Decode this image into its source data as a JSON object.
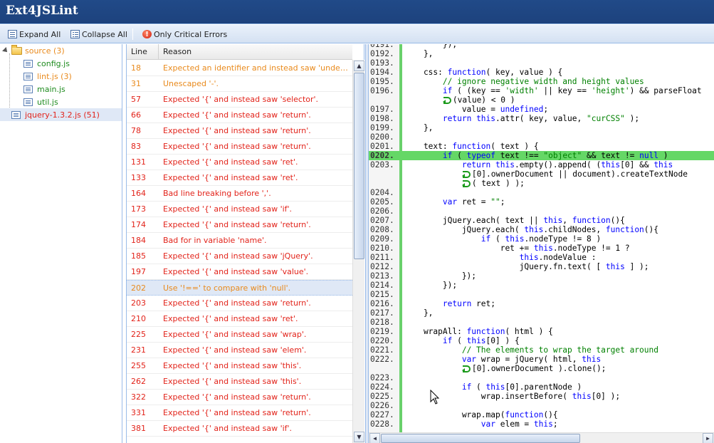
{
  "app": {
    "title": "Ext4JSLint"
  },
  "toolbar": {
    "expand_all": "Expand All",
    "collapse_all": "Collapse All",
    "only_critical": "Only Critical Errors"
  },
  "tree": {
    "items": [
      {
        "label": "source (3)",
        "type": "folder",
        "color": "orange"
      },
      {
        "label": "config.js",
        "type": "file",
        "color": "green"
      },
      {
        "label": "lint.js (3)",
        "type": "file",
        "color": "orange"
      },
      {
        "label": "main.js",
        "type": "file",
        "color": "green"
      },
      {
        "label": "util.js",
        "type": "file",
        "color": "green"
      },
      {
        "label": "jquery-1.3.2.js (51)",
        "type": "file",
        "color": "red",
        "selected": true
      }
    ]
  },
  "grid": {
    "columns": {
      "line": "Line",
      "reason": "Reason"
    },
    "rows": [
      {
        "line": "18",
        "reason": "Expected an identifier and instead saw 'undefined' (...",
        "severity": "orange"
      },
      {
        "line": "31",
        "reason": "Unescaped '-'.",
        "severity": "orange"
      },
      {
        "line": "57",
        "reason": "Expected '{' and instead saw 'selector'.",
        "severity": "red"
      },
      {
        "line": "66",
        "reason": "Expected '{' and instead saw 'return'.",
        "severity": "red"
      },
      {
        "line": "78",
        "reason": "Expected '{' and instead saw 'return'.",
        "severity": "red"
      },
      {
        "line": "83",
        "reason": "Expected '{' and instead saw 'return'.",
        "severity": "red"
      },
      {
        "line": "131",
        "reason": "Expected '{' and instead saw 'ret'.",
        "severity": "red"
      },
      {
        "line": "133",
        "reason": "Expected '{' and instead saw 'ret'.",
        "severity": "red"
      },
      {
        "line": "164",
        "reason": "Bad line breaking before ','.",
        "severity": "red"
      },
      {
        "line": "173",
        "reason": "Expected '{' and instead saw 'if'.",
        "severity": "red"
      },
      {
        "line": "174",
        "reason": "Expected '{' and instead saw 'return'.",
        "severity": "red"
      },
      {
        "line": "184",
        "reason": "Bad for in variable 'name'.",
        "severity": "red"
      },
      {
        "line": "185",
        "reason": "Expected '{' and instead saw 'jQuery'.",
        "severity": "red"
      },
      {
        "line": "197",
        "reason": "Expected '{' and instead saw 'value'.",
        "severity": "red"
      },
      {
        "line": "202",
        "reason": "Use '!==' to compare with 'null'.",
        "severity": "orange",
        "selected": true
      },
      {
        "line": "203",
        "reason": "Expected '{' and instead saw 'return'.",
        "severity": "red"
      },
      {
        "line": "210",
        "reason": "Expected '{' and instead saw 'ret'.",
        "severity": "red"
      },
      {
        "line": "225",
        "reason": "Expected '{' and instead saw 'wrap'.",
        "severity": "red"
      },
      {
        "line": "231",
        "reason": "Expected '{' and instead saw 'elem'.",
        "severity": "red"
      },
      {
        "line": "255",
        "reason": "Expected '{' and instead saw 'this'.",
        "severity": "red"
      },
      {
        "line": "262",
        "reason": "Expected '{' and instead saw 'this'.",
        "severity": "red"
      },
      {
        "line": "322",
        "reason": "Expected '{' and instead saw 'return'.",
        "severity": "red"
      },
      {
        "line": "331",
        "reason": "Expected '{' and instead saw 'return'.",
        "severity": "red"
      },
      {
        "line": "381",
        "reason": "Expected '{' and instead saw 'if'.",
        "severity": "red"
      }
    ]
  },
  "code": {
    "highlighted_line": "0202.",
    "lines": [
      {
        "num": "0191.",
        "text": "        });"
      },
      {
        "num": "0192.",
        "text": "    },"
      },
      {
        "num": "0193.",
        "text": ""
      },
      {
        "num": "0194.",
        "text": "    css: function( key, value ) {"
      },
      {
        "num": "0195.",
        "text": "        // ignore negative width and height values"
      },
      {
        "num": "0196.",
        "text": "        if ( (key == 'width' || key == 'height') && parseFloat"
      },
      {
        "num": "",
        "text": "(value) < 0 )",
        "wrapped": true,
        "indent": 8
      },
      {
        "num": "0197.",
        "text": "            value = undefined;"
      },
      {
        "num": "0198.",
        "text": "        return this.attr( key, value, \"curCSS\" );"
      },
      {
        "num": "0199.",
        "text": "    },"
      },
      {
        "num": "0200.",
        "text": ""
      },
      {
        "num": "0201.",
        "text": "    text: function( text ) {"
      },
      {
        "num": "0202.",
        "text": "        if ( typeof text !== \"object\" && text != null )"
      },
      {
        "num": "0203.",
        "text": "            return this.empty().append( (this[0] && this"
      },
      {
        "num": "",
        "text": "[0].ownerDocument || document).createTextNode",
        "wrapped": true,
        "indent": 12
      },
      {
        "num": "",
        "text": "( text ) );",
        "wrapped": true,
        "indent": 12
      },
      {
        "num": "0204.",
        "text": ""
      },
      {
        "num": "0205.",
        "text": "        var ret = \"\";"
      },
      {
        "num": "0206.",
        "text": ""
      },
      {
        "num": "0207.",
        "text": "        jQuery.each( text || this, function(){"
      },
      {
        "num": "0208.",
        "text": "            jQuery.each( this.childNodes, function(){"
      },
      {
        "num": "0209.",
        "text": "                if ( this.nodeType != 8 )"
      },
      {
        "num": "0210.",
        "text": "                    ret += this.nodeType != 1 ?"
      },
      {
        "num": "0211.",
        "text": "                        this.nodeValue :"
      },
      {
        "num": "0212.",
        "text": "                        jQuery.fn.text( [ this ] );"
      },
      {
        "num": "0213.",
        "text": "            });"
      },
      {
        "num": "0214.",
        "text": "        });"
      },
      {
        "num": "0215.",
        "text": ""
      },
      {
        "num": "0216.",
        "text": "        return ret;"
      },
      {
        "num": "0217.",
        "text": "    },"
      },
      {
        "num": "0218.",
        "text": ""
      },
      {
        "num": "0219.",
        "text": "    wrapAll: function( html ) {"
      },
      {
        "num": "0220.",
        "text": "        if ( this[0] ) {"
      },
      {
        "num": "0221.",
        "text": "            // The elements to wrap the target around"
      },
      {
        "num": "0222.",
        "text": "            var wrap = jQuery( html, this"
      },
      {
        "num": "",
        "text": "[0].ownerDocument ).clone();",
        "wrapped": true,
        "indent": 12
      },
      {
        "num": "0223.",
        "text": ""
      },
      {
        "num": "0224.",
        "text": "            if ( this[0].parentNode )"
      },
      {
        "num": "0225.",
        "text": "                wrap.insertBefore( this[0] );"
      },
      {
        "num": "0226.",
        "text": ""
      },
      {
        "num": "0227.",
        "text": "            wrap.map(function(){"
      },
      {
        "num": "0228.",
        "text": "                var elem = this;"
      }
    ]
  },
  "colors": {
    "title_bar": "#1f4782",
    "error_red": "#e2231a",
    "warning_orange": "#e98a1c",
    "ok_green": "#1e8b1e",
    "highlight_green": "#65d766",
    "keyword_blue": "#0000ff",
    "string_green": "#008000"
  },
  "icons": {
    "expand_all": "expand-all-icon",
    "collapse_all": "collapse-all-icon",
    "critical": "critical-error-icon",
    "folder": "folder-icon",
    "file": "file-icon",
    "wrap": "line-wrap-icon"
  }
}
